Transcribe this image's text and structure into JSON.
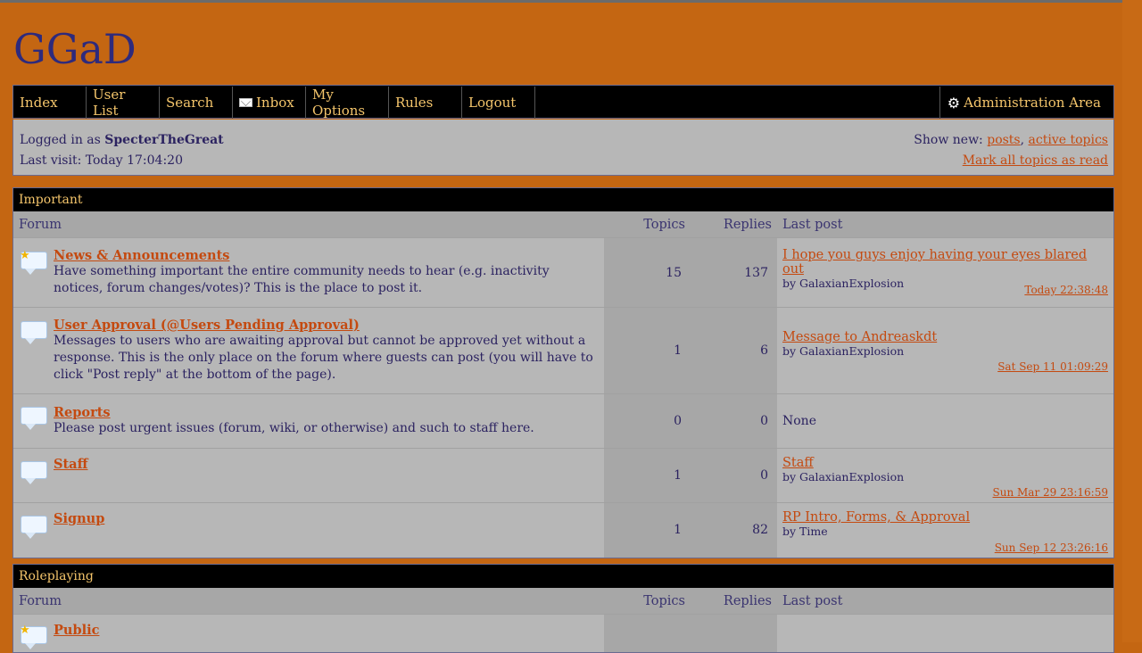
{
  "site": {
    "title": "GGaD"
  },
  "nav": {
    "index": "Index",
    "user_list": "User List",
    "search": "Search",
    "inbox": "Inbox",
    "my_options": "My Options",
    "rules": "Rules",
    "logout": "Logout",
    "admin": "Administration Area"
  },
  "status": {
    "logged_in_prefix": "Logged in as",
    "username": "SpecterTheGreat",
    "last_visit": "Last visit: Today 17:04:20",
    "show_new_prefix": "Show new:",
    "posts": "posts",
    "comma": ",",
    "active_topics": "active topics",
    "mark_all": "Mark all topics as read"
  },
  "columns": {
    "forum": "Forum",
    "topics": "Topics",
    "replies": "Replies",
    "last_post": "Last post"
  },
  "categories": [
    {
      "name": "Important",
      "forums": [
        {
          "title": "News & Announcements",
          "desc": "Have something important the entire community needs to hear (e.g. inactivity notices, forum changes/votes)? This is the place to post it.",
          "topics": "15",
          "replies": "137",
          "last_title": "I hope you guys enjoy having your eyes blared out",
          "last_by": "by GalaxianExplosion",
          "last_date": "Today 22:38:48"
        },
        {
          "title": "User Approval (@Users Pending Approval)",
          "desc": "Messages to users who are awaiting approval but cannot be approved yet without a response. This is the only place on the forum where guests can post (you will have to click \"Post reply\" at the bottom of the page).",
          "topics": "1",
          "replies": "6",
          "last_title": "Message to Andreaskdt",
          "last_by": "by GalaxianExplosion",
          "last_date": "Sat Sep 11 01:09:29"
        },
        {
          "title": "Reports",
          "desc": "Please post urgent issues (forum, wiki, or otherwise) and such to staff here.",
          "topics": "0",
          "replies": "0",
          "last_none": "None"
        },
        {
          "title": "Staff",
          "desc": "",
          "topics": "1",
          "replies": "0",
          "last_title": "Staff",
          "last_by": "by GalaxianExplosion",
          "last_date": "Sun Mar 29 23:16:59"
        },
        {
          "title": "Signup",
          "desc": "",
          "topics": "1",
          "replies": "82",
          "last_title": "RP Intro, Forms, & Approval",
          "last_by": "by Time",
          "last_date": "Sun Sep 12 23:26:16"
        }
      ]
    },
    {
      "name": "Roleplaying",
      "forums": [
        {
          "title": "Public"
        }
      ]
    }
  ],
  "colors": {
    "background": "#c46612",
    "panel": "#b7b7b7",
    "header": "#000000",
    "link": "#c44a10",
    "nav_text": "#f4c56b"
  }
}
